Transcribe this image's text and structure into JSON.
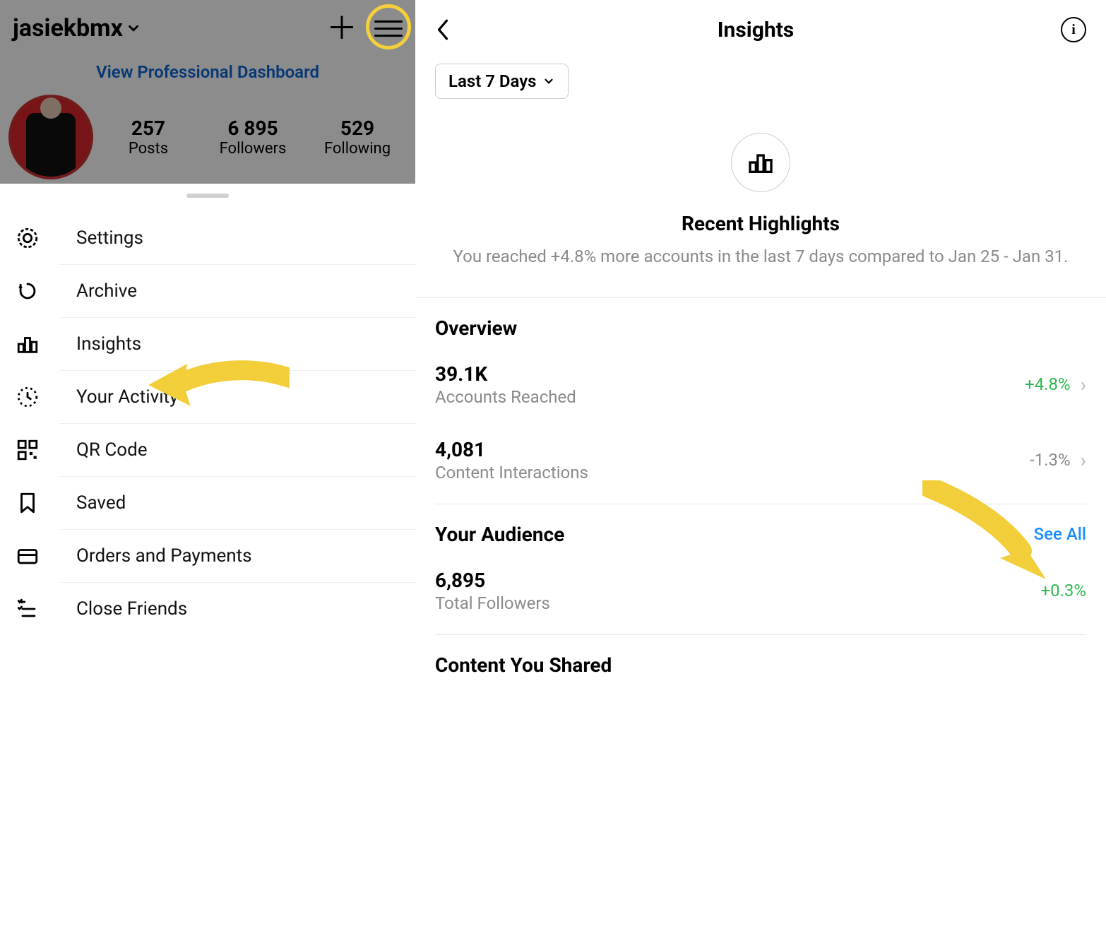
{
  "left": {
    "username": "jasiekbmx",
    "dashboard_link": "View Professional Dashboard",
    "stats": {
      "posts": {
        "value": "257",
        "label": "Posts"
      },
      "followers": {
        "value": "6 895",
        "label": "Followers"
      },
      "following": {
        "value": "529",
        "label": "Following"
      }
    },
    "menu": {
      "settings": "Settings",
      "archive": "Archive",
      "insights": "Insights",
      "activity": "Your Activity",
      "qr": "QR Code",
      "saved": "Saved",
      "orders": "Orders and Payments",
      "close_friends": "Close Friends"
    }
  },
  "right": {
    "title": "Insights",
    "period": "Last 7 Days",
    "highlights": {
      "title": "Recent Highlights",
      "subtitle": "You reached +4.8% more accounts in the last 7 days compared to Jan 25 - Jan 31."
    },
    "overview": {
      "title": "Overview",
      "reached": {
        "value": "39.1K",
        "label": "Accounts Reached",
        "pct": "+4.8%"
      },
      "interactions": {
        "value": "4,081",
        "label": "Content Interactions",
        "pct": "-1.3%"
      }
    },
    "audience": {
      "title": "Your Audience",
      "see_all": "See All",
      "followers": {
        "value": "6,895",
        "label": "Total Followers",
        "pct": "+0.3%"
      }
    },
    "content": {
      "title": "Content You Shared"
    }
  }
}
